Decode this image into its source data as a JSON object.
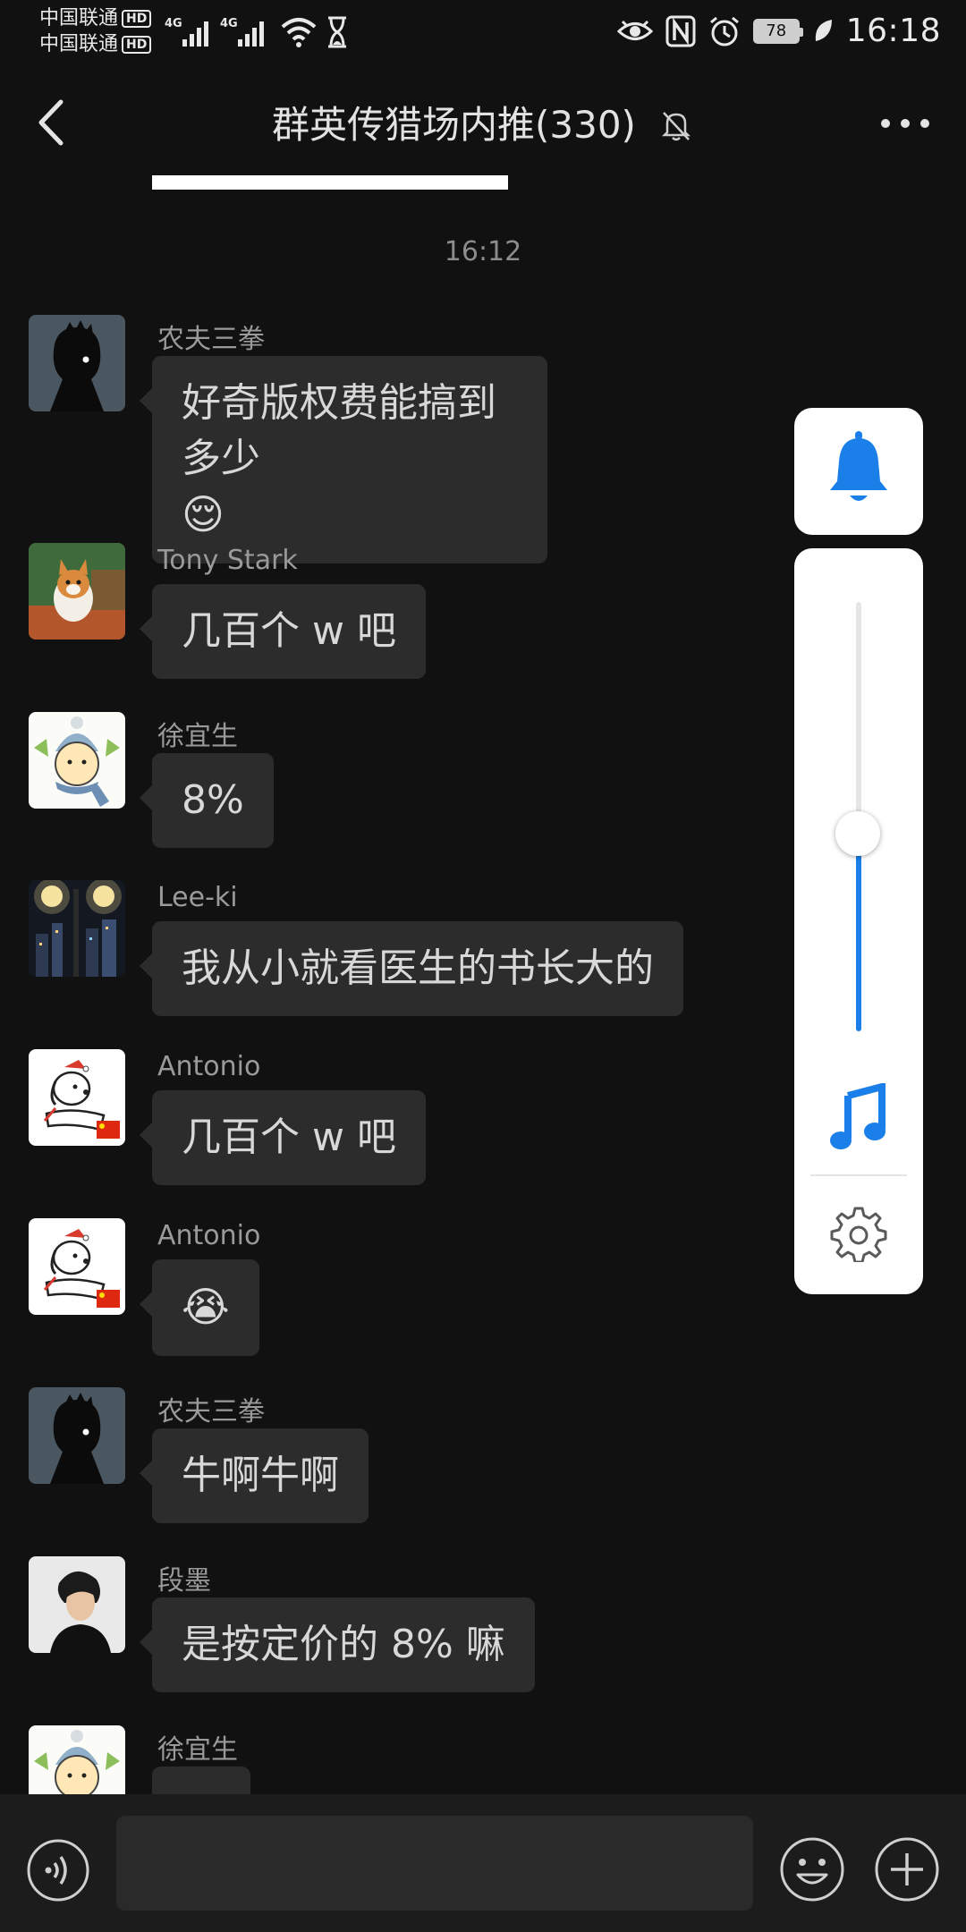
{
  "status_bar": {
    "carrier_1": "中国联通",
    "carrier_2": "中国联通",
    "hd_badge": "HD",
    "network_1": "4G",
    "network_2": "4G",
    "battery": "78",
    "time": "16:18",
    "icons": [
      "signal-icon",
      "wifi-icon",
      "hourglass-icon",
      "eye-icon",
      "nfc-icon",
      "alarm-icon",
      "battery-icon",
      "leaf-icon"
    ]
  },
  "header": {
    "title": "群英传猎场内推(330)",
    "icons": [
      "back-arrow-icon",
      "mute-bell-icon",
      "more-dots-icon"
    ]
  },
  "chat": {
    "timestamp": "16:12",
    "messages": [
      {
        "sender": "农夫三拳",
        "text": "好奇版权费能搞到多少",
        "emoji": "😌",
        "avatar": "silhouette"
      },
      {
        "sender": "Tony Stark",
        "text": "几百个 w 吧",
        "avatar": "corgi"
      },
      {
        "sender": "徐宜生",
        "text": "8%",
        "avatar": "snowman"
      },
      {
        "sender": "Lee-ki",
        "text": "我从小就看医生的书长大的",
        "avatar": "night-city"
      },
      {
        "sender": "Antonio",
        "text": "几百个 w 吧",
        "avatar": "dog-sketch"
      },
      {
        "sender": "Antonio",
        "emoji": "😭",
        "avatar": "dog-sketch"
      },
      {
        "sender": "农夫三拳",
        "text": "牛啊牛啊",
        "avatar": "silhouette"
      },
      {
        "sender": "段墨",
        "text": "是按定价的 8% 嘛",
        "avatar": "portrait"
      },
      {
        "sender": "徐宜生",
        "text": "",
        "avatar": "snowman"
      }
    ]
  },
  "volume_panel": {
    "level_percent": 46,
    "icons": [
      "bell-icon",
      "music-note-icon",
      "settings-gear-icon"
    ],
    "accent_color": "#1a7fe8"
  },
  "input_bar": {
    "placeholder": "",
    "icons": [
      "voice-icon",
      "emoji-icon",
      "plus-icon"
    ]
  }
}
